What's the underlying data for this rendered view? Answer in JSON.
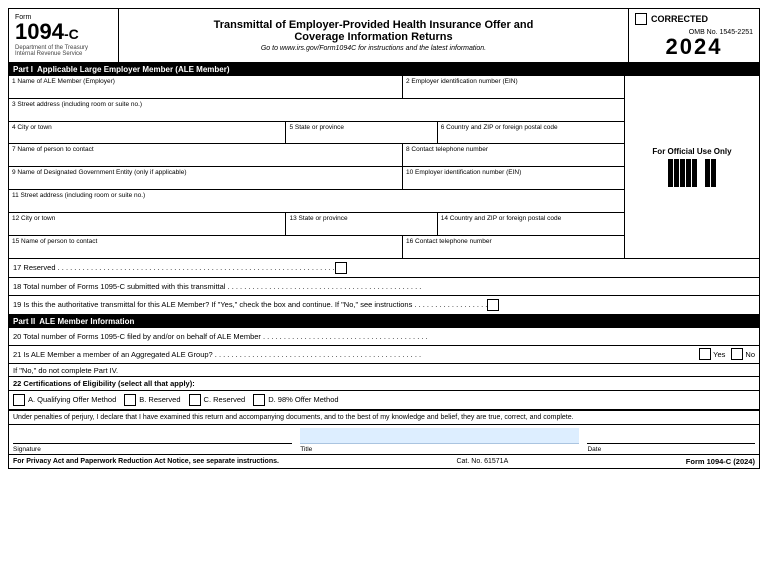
{
  "header": {
    "form_label": "Form",
    "form_number": "1094",
    "form_suffix": "-C",
    "dept_line1": "Department of the Treasury",
    "dept_line2": "Internal Revenue Service",
    "title_line1": "Transmittal of Employer-Provided Health Insurance Offer and",
    "title_line2": "Coverage Information Returns",
    "url_text": "Go to www.irs.gov/Form1094C for instructions and the latest information.",
    "corrected_label": "CORRECTED",
    "omb_label": "OMB No. 1545-2251",
    "year": "2024"
  },
  "part1": {
    "label": "Part I",
    "title": "Applicable Large Employer Member (ALE Member)",
    "fields": {
      "f1_label": "1  Name of ALE Member (Employer)",
      "f2_label": "2  Employer identification number (EIN)",
      "f3_label": "3  Street address (including room or suite no.)",
      "f4_label": "4  City or town",
      "f5_label": "5  State or province",
      "f6_label": "6  Country and ZIP or foreign postal code",
      "f7_label": "7  Name of person to contact",
      "f8_label": "8  Contact telephone number",
      "f9_label": "9  Name of Designated Government Entity (only if applicable)",
      "f10_label": "10  Employer identification number (EIN)",
      "f11_label": "11  Street address (including room or suite no.)",
      "f12_label": "12  City or town",
      "f13_label": "13  State or province",
      "f14_label": "14  Country and ZIP or foreign postal code",
      "f15_label": "15  Name of person to contact",
      "f16_label": "16  Contact telephone number"
    }
  },
  "official_use": {
    "title": "For Official Use Only"
  },
  "dotted_rows": {
    "r17": "17  Reserved . . . . . . . . . . . . . . . . . . . . . . . . . . . . . . . . . . . . . . . . . . . . . . . . . . . . . . . . . . . . . . . . . . .",
    "r18": "18  Total number of Forms 1095-C submitted with this transmittal . . . . . . . . . . . . . . . . . . . . . . . . . . . . . . . . . . . . . . . . . . . . . . .",
    "r19": "19  Is this the authoritative transmittal for this ALE Member? If \"Yes,\" check the box and continue. If \"No,\" see instructions . . . . . . . . . . . . . . . . . ."
  },
  "part2": {
    "label": "Part II",
    "title": "ALE Member Information",
    "r20": "20  Total number of Forms 1095-C filed by and/or on behalf of ALE Member . . . . . . . . . . . . . . . . . . . . . . . . . . . . . . . . . . . . . . . .",
    "r21_text": "21  Is ALE Member a member of an Aggregated ALE Group? . . . . . . . . . . . . . . . . . . . . . . . . . . . . . . . . . . . . . . . . . . . . . . . . . .",
    "r21_yes": "Yes",
    "r21_no": "No",
    "r21_note": "If \"No,\" do not complete Part IV.",
    "r22_label": "22  Certifications of Eligibility (select all that apply):",
    "cert_a": "A.  Qualifying Offer Method",
    "cert_b": "B.  Reserved",
    "cert_c": "C.  Reserved",
    "cert_d": "D.  98% Offer Method"
  },
  "perjury_text": "Under penalties of perjury, I declare that I have examined this return and accompanying documents, and to the best of my knowledge and belief, they are true, correct, and complete.",
  "signature_labels": {
    "sig": "Signature",
    "title": "Title",
    "date": "Date"
  },
  "footer": {
    "left": "For Privacy Act and Paperwork Reduction Act Notice, see separate instructions.",
    "center": "Cat. No. 61571A",
    "right": "Form 1094-C (2024)"
  }
}
